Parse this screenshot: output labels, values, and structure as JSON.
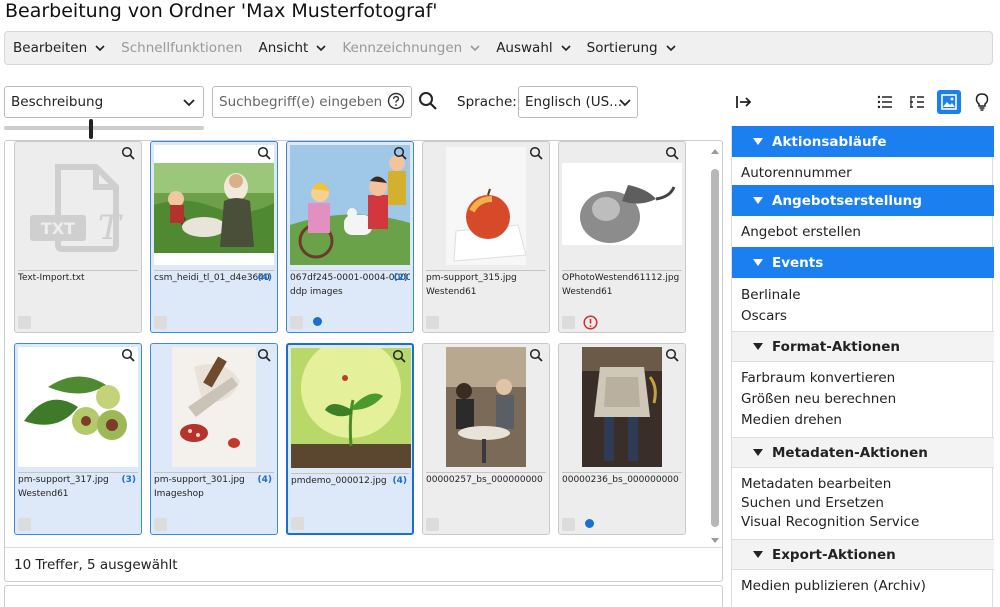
{
  "page": {
    "title": "Bearbeitung von Ordner 'Max Musterfotograf'"
  },
  "menubar": {
    "items": [
      {
        "label": "Bearbeiten"
      },
      {
        "label": "Schnellfunktionen"
      },
      {
        "label": "Ansicht"
      },
      {
        "label": "Kennzeichnungen"
      },
      {
        "label": "Auswahl"
      },
      {
        "label": "Sortierung"
      }
    ]
  },
  "filter": {
    "field_value": "Beschreibung",
    "slider_level": 0.45
  },
  "search": {
    "placeholder": "Suchbegriff(e) eingeben"
  },
  "language": {
    "label": "Sprache:",
    "value": "Englisch (US..."
  },
  "grid": {
    "tiles": [
      {
        "filename": "Text-Import.txt",
        "count": "",
        "subline": ""
      },
      {
        "filename": "csm_heidi_tl_01_d4e3640",
        "count": "(4)",
        "subline": ""
      },
      {
        "filename": "067df245-0001-0004-0000",
        "count": "(2)",
        "subline": "ddp images"
      },
      {
        "filename": "pm-support_315.jpg",
        "count": "",
        "subline": "Westend61"
      },
      {
        "filename": "OPhotoWestend61112.jpg",
        "count": "",
        "subline": "Westend61"
      },
      {
        "filename": "pm-support_317.jpg",
        "count": "(3)",
        "subline": "Westend61"
      },
      {
        "filename": "pm-support_301.jpg",
        "count": "(4)",
        "subline": "Imageshop"
      },
      {
        "filename": "pmdemo_000012.jpg",
        "count": "(4)",
        "subline": ""
      },
      {
        "filename": "00000257_bs_000000000",
        "count": "",
        "subline": ""
      },
      {
        "filename": "00000236_bs_000000000",
        "count": "",
        "subline": ""
      }
    ],
    "footer": "10 Treffer, 5 ausgewählt"
  },
  "sidebar": {
    "sections": [
      {
        "title": "Aktionsabläufe",
        "items": [
          "Autorennummer"
        ]
      },
      {
        "title": "Angebotserstellung",
        "items": [
          "Angebot erstellen"
        ]
      },
      {
        "title": "Events",
        "items": [
          "Berlinale",
          "Oscars"
        ]
      },
      {
        "title": "Format-Aktionen",
        "items": [
          "Farbraum konvertieren",
          "Größen neu berechnen",
          "Medien drehen"
        ]
      },
      {
        "title": "Metadaten-Aktionen",
        "items": [
          "Metadaten bearbeiten",
          "Suchen und Ersetzen",
          "Visual Recognition Service"
        ]
      },
      {
        "title": "Export-Aktionen",
        "items": [
          "Medien publizieren (Archiv)"
        ]
      }
    ]
  },
  "colors": {
    "accent": "#1b7ff0",
    "selected_tile": "#dde9f8",
    "warning": "#d32f2f"
  },
  "icons": [
    "chevron-down-icon",
    "help-icon",
    "search-icon",
    "export-icon",
    "list-view-icon",
    "detail-list-icon",
    "gallery-view-icon",
    "lightbulb-icon",
    "zoom-icon",
    "warning-icon"
  ]
}
